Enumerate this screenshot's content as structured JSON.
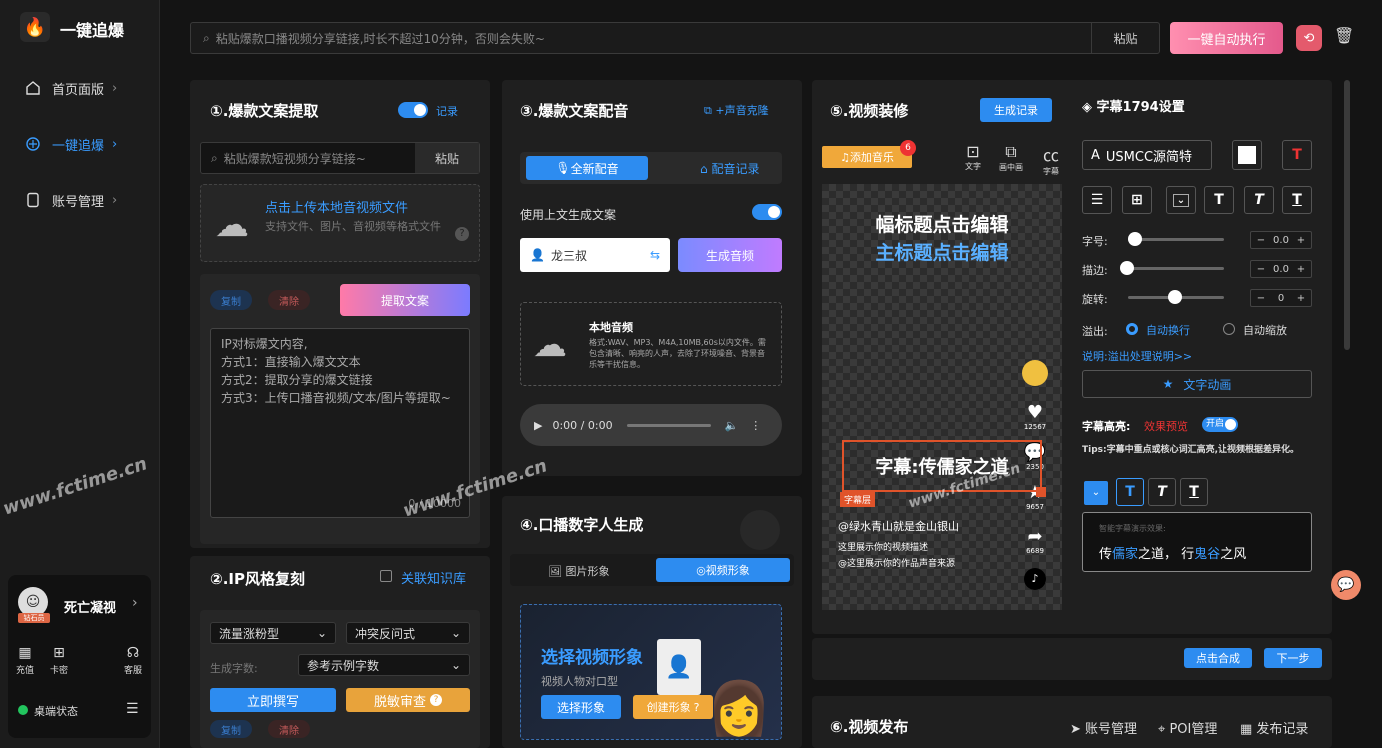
{
  "app": {
    "title": "一键追爆"
  },
  "nav": [
    {
      "label": "首页面版"
    },
    {
      "label": "一键追爆"
    },
    {
      "label": "账号管理"
    }
  ],
  "user": {
    "name": "死亡凝视",
    "badge": "钻石员",
    "actions": [
      "充值",
      "卡密",
      "客服"
    ],
    "status": "桌端状态"
  },
  "topbar": {
    "placeholder": "粘贴爆款口播视频分享链接,时长不超过10分钟，否则会失败~",
    "paste": "粘贴",
    "run": "一键自动执行"
  },
  "p1": {
    "title": "①.爆款文案提取",
    "record": "记录",
    "placeholder": "粘贴爆款短视频分享链接~",
    "paste": "粘贴",
    "upload_title": "点击上传本地音视频文件",
    "upload_desc": "支持文件、图片、音视频等格式文件",
    "copy": "复制",
    "clear": "清除",
    "extract": "提取文案",
    "text_lines": [
      "IP对标爆文内容,",
      "方式1：直接输入爆文文本",
      "方式2：提取分享的爆文链接",
      "方式3：上传口播音视频/文本/图片等提取~"
    ],
    "counter": "0 / 10000"
  },
  "p2": {
    "title": "②.IP风格复刻",
    "kb": "关联知识库",
    "sel1": "流量涨粉型",
    "sel2": "冲突反问式",
    "count_label": "生成字数:",
    "count_sel": "参考示例字数",
    "write": "立即撰写",
    "check": "脱敏审查",
    "copy": "复制",
    "clear": "清除"
  },
  "p3": {
    "title": "③.爆款文案配音",
    "clone": "+声音克隆",
    "tab_new": "全新配音",
    "tab_record": "配音记录",
    "use_above": "使用上文生成文案",
    "voice": "龙三叔",
    "gen_audio": "生成音频",
    "local_title": "本地音频",
    "local_desc": "格式:WAV、MP3、M4A,10MB,60s以内文件。需包含清晰、响亮的人声，去除了环境噪音、背景音乐等干扰信息。",
    "time": "0:00 / 0:00"
  },
  "p4": {
    "title": "④.口播数字人生成",
    "tab_img": "图片形象",
    "tab_video": "视频形象",
    "choose_title": "选择视频形象",
    "choose_desc": "视频人物对口型",
    "choose_btn": "选择形象",
    "create_btn": "创建形象"
  },
  "p5": {
    "title": "⑤.视频装修",
    "gen_record": "生成记录",
    "add_music": "添加音乐",
    "music_badge": "6",
    "tools": [
      "文字",
      "画中画",
      "字幕"
    ],
    "sub_title": "幅标题点击编辑",
    "main_title": "主标题点击编辑",
    "caption": "字幕:传儒家之道",
    "caption_tag": "字幕层",
    "author": "@绿水青山就是金山银山",
    "desc1": "这里展示你的视频描述",
    "desc2": "@这里展示你的作品声音来源",
    "likes": "12567",
    "comments": "2350",
    "stars": "9657",
    "shares": "6689",
    "compose": "点击合成",
    "next": "下一步"
  },
  "sub": {
    "title": "字幕1794设置",
    "font": "USMCC源简特",
    "size_label": "字号:",
    "stroke_label": "描边:",
    "rotate_label": "旋转:",
    "size_val": "0.0",
    "stroke_val": "0.0",
    "rotate_val": "0",
    "overflow_label": "溢出:",
    "auto_wrap": "自动换行",
    "auto_scale": "自动缩放",
    "help": "说明:溢出处理说明>>",
    "anim": "文字动画",
    "hl_label": "字幕高亮:",
    "hl_preview": "效果预览",
    "hl_on": "开启",
    "tips": "Tips:字幕中重点或核心词汇高亮,让视频根据差异化。",
    "preview_hint": "智能字幕演示效果:",
    "preview_a": "传",
    "preview_b": "儒家",
    "preview_c": "之道，  行",
    "preview_d": "鬼谷",
    "preview_e": "之风"
  },
  "p6": {
    "title": "⑥.视频发布",
    "account": "账号管理",
    "poi": "POI管理",
    "publish": "发布记录"
  },
  "wm": "www.fctime.cn"
}
